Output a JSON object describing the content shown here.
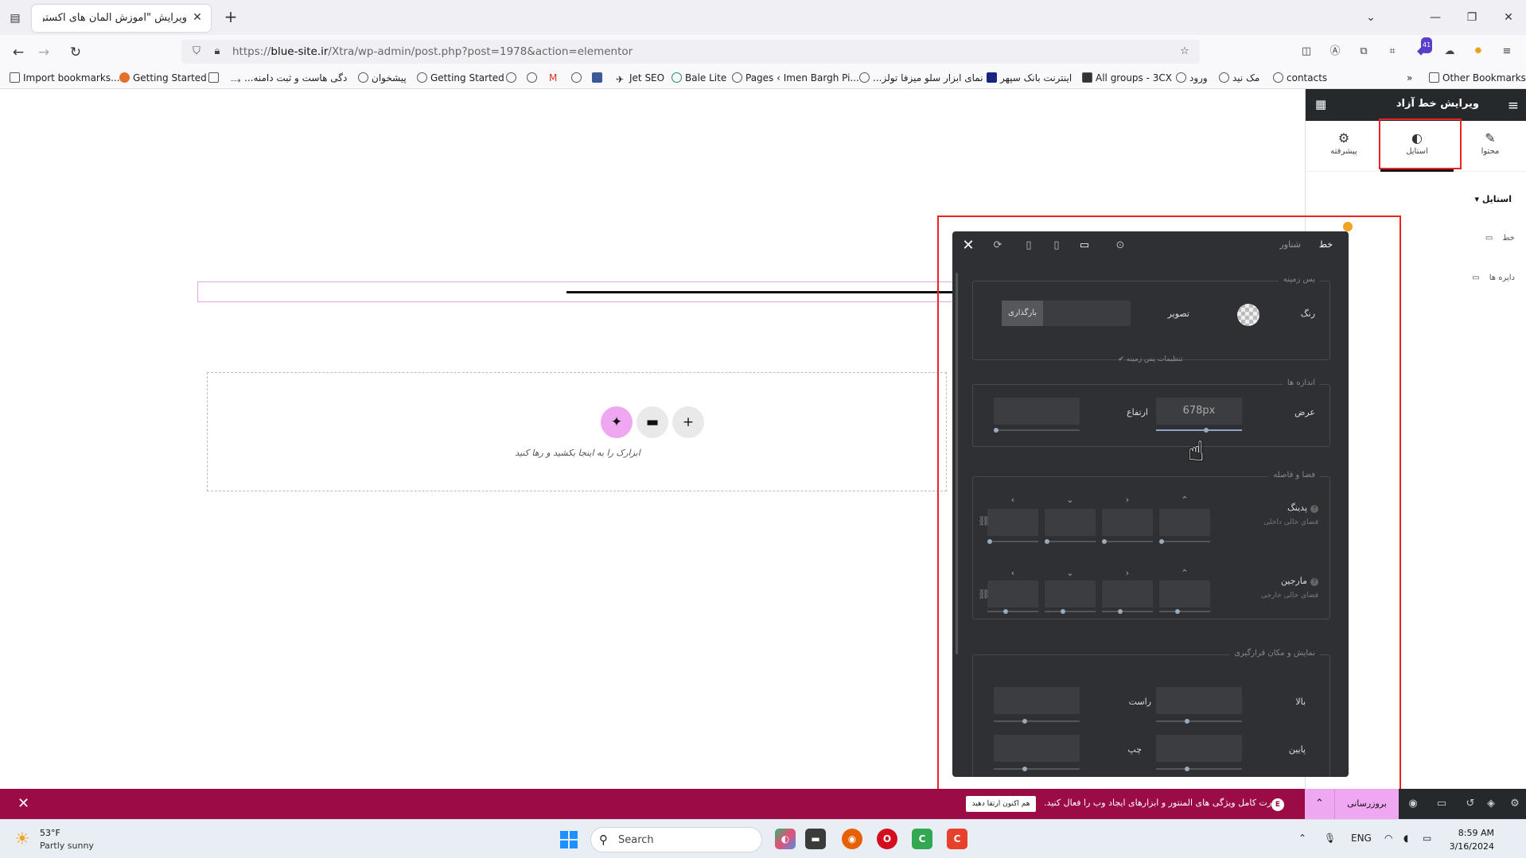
{
  "browser": {
    "tab_title": "ویرایش \"آموزش المان های اکسترا - ...",
    "url_prefix": "https://",
    "url_domain": "blue-site.ir",
    "url_rest": "/Xtra/wp-admin/post.php?post=1978&action=elementor",
    "extension_badge": "41",
    "bookmarks": [
      "Import bookmarks...",
      "Getting Started",
      "...دگی هاست و ثبت دامنه",
      "پیشخوان",
      "Getting Started",
      "Jet SEO",
      "Bale Lite",
      "Pages ‹ Imen Bargh Pi...",
      "...نمای ابزار سلو میزفا تولز",
      "اینترنت بانک سپهر",
      "All groups - 3CX",
      "ورود",
      "مک نید",
      "contacts"
    ],
    "other_bookmarks": "Other Bookmarks"
  },
  "canvas": {
    "drop_hint": "ابزارک را به اینجا بکشید و رها کنید"
  },
  "panel": {
    "title": "ویرایش خط آزاد",
    "tabs": [
      {
        "label": "محتوا",
        "icon": "pencil-icon"
      },
      {
        "label": "استایل",
        "icon": "contrast-icon"
      },
      {
        "label": "پیشرفته",
        "icon": "gear-icon"
      }
    ],
    "section_title": "استایل",
    "controls": [
      "خط",
      "دایره ها"
    ]
  },
  "popover": {
    "tabs": [
      "خط",
      "شناور"
    ],
    "background_legend": "پس زمینه",
    "color_label": "رنگ",
    "image_label": "تصویر",
    "upload_label": "بارگذاری",
    "background_settings": "تنظیمات پس زمینه",
    "sizes_legend": "اندازه ها",
    "width_label": "عرض",
    "width_value": "678px",
    "height_label": "ارتفاع",
    "spacing_legend": "فضا و فاصله",
    "padding_label": "پدینگ",
    "padding_sub": "فضای خالی داخلی",
    "margin_label": "مارجین",
    "margin_sub": "فضای خالی خارجی",
    "position_legend": "نمایش و مکان قرارگیری",
    "top_label": "بالا",
    "right_label": "راست",
    "bottom_label": "پایین",
    "left_label": "چپ"
  },
  "promo": {
    "text": "قدرت کامل ویژگی های المنتور و ابزارهای ایجاد وب را فعال کنید.",
    "button": "هم اکنون ارتقا دهید",
    "update_button": "بروزرسانی"
  },
  "taskbar": {
    "temperature": "53°F",
    "weather": "Partly sunny",
    "search_placeholder": "Search",
    "language": "ENG",
    "time": "8:59 AM",
    "date": "3/16/2024"
  },
  "colors": {
    "accent_pink": "#f0a7f2",
    "promo_bg": "#9b0c47",
    "panel_dark": "#26292c",
    "popover_bg": "#2f3033"
  }
}
